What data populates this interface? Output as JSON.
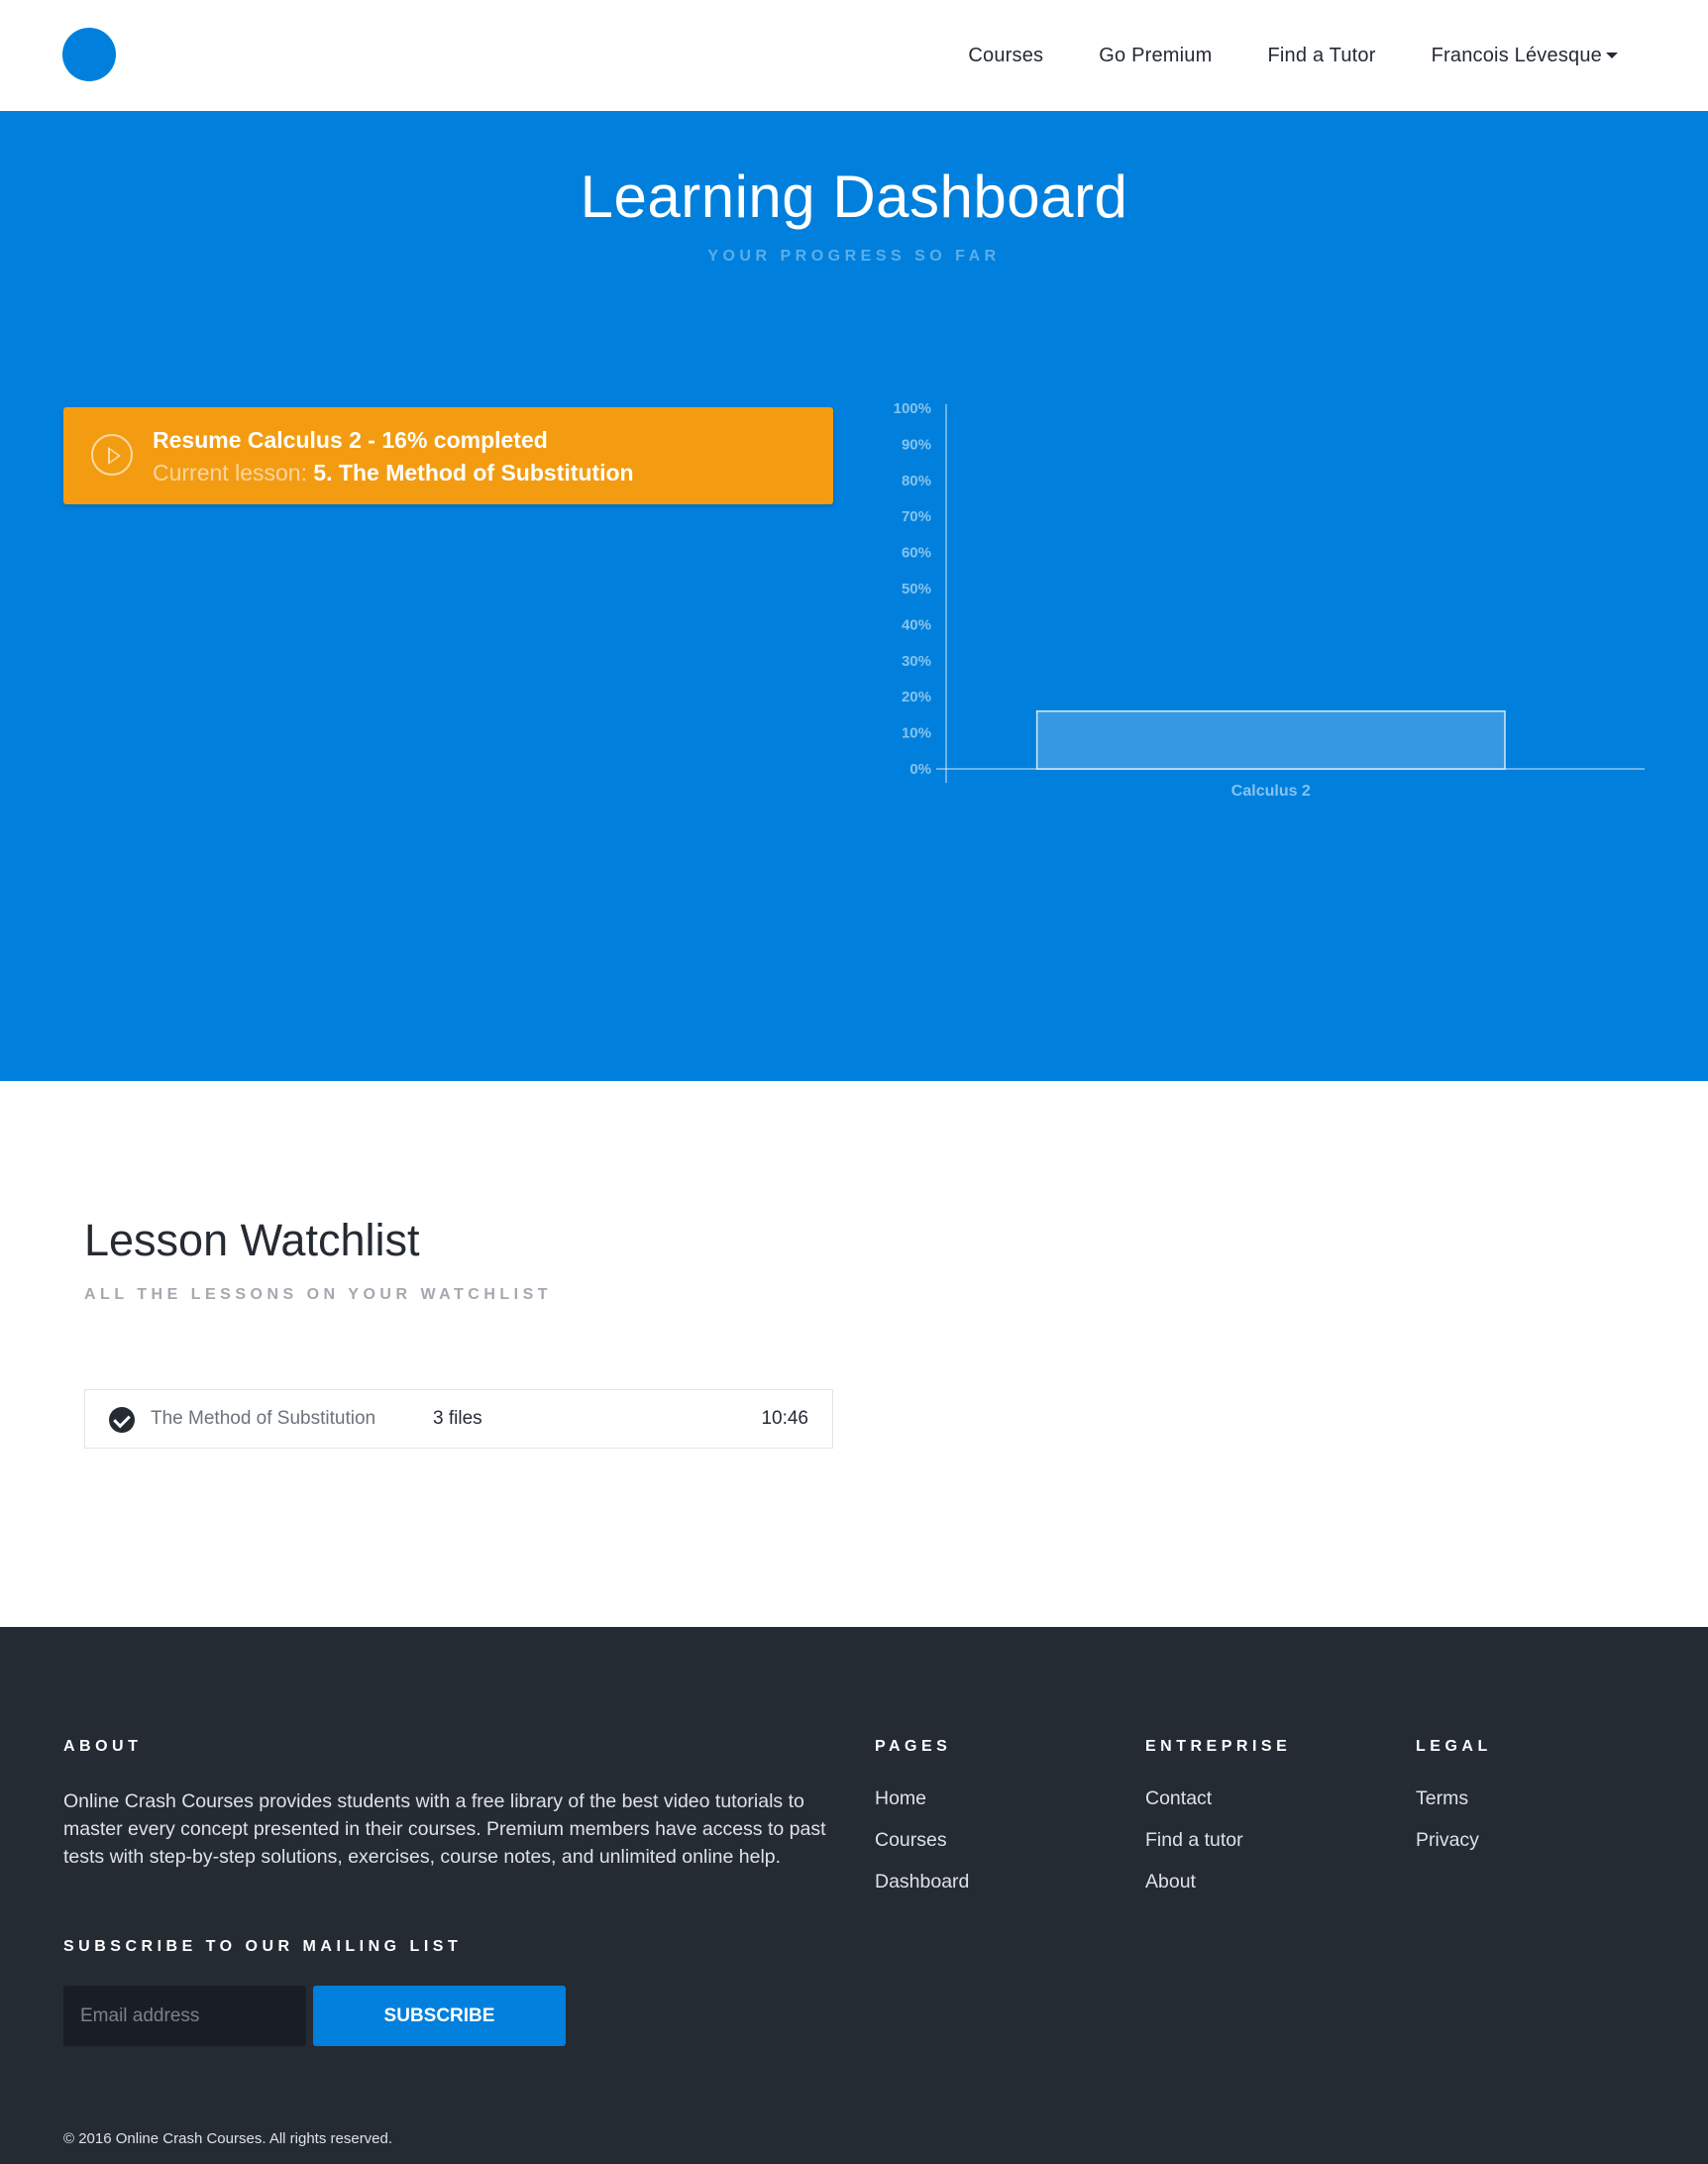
{
  "nav": {
    "links": [
      "Courses",
      "Go Premium",
      "Find a Tutor"
    ],
    "user_name": "Francois Lévesque"
  },
  "hero": {
    "title": "Learning Dashboard",
    "subtitle": "YOUR PROGRESS SO FAR",
    "resume": {
      "headline": "Resume Calculus 2 - 16% completed",
      "lesson_prefix": "Current lesson:",
      "lesson_name": "5. The Method of Substitution"
    }
  },
  "chart_data": {
    "type": "bar",
    "categories": [
      "Calculus 2"
    ],
    "values": [
      16
    ],
    "ylim": [
      0,
      100
    ],
    "yticks": [
      "0%",
      "10%",
      "20%",
      "30%",
      "40%",
      "50%",
      "60%",
      "70%",
      "80%",
      "90%",
      "100%"
    ],
    "grid": false,
    "bar_color": "#3498e3"
  },
  "watchlist": {
    "title": "Lesson Watchlist",
    "subtitle": "ALL THE LESSONS ON YOUR WATCHLIST",
    "items": [
      {
        "name": "The Method of Substitution",
        "files": "3 files",
        "duration": "10:46"
      }
    ]
  },
  "footer": {
    "about_heading": "ABOUT",
    "about_text": "Online Crash Courses provides students with a free library of the best video tutorials to master every concept presented in their courses. Premium members have access to past tests with step-by-step solutions, exercises, course notes, and unlimited online help.",
    "pages_heading": "PAGES",
    "pages": [
      "Home",
      "Courses",
      "Dashboard"
    ],
    "entreprise_heading": "ENTREPRISE",
    "entreprise": [
      "Contact",
      "Find a tutor",
      "About"
    ],
    "legal_heading": "LEGAL",
    "legal": [
      "Terms",
      "Privacy"
    ],
    "subscribe_heading": "SUBSCRIBE TO OUR MAILING LIST",
    "email_placeholder": "Email address",
    "subscribe_label": "SUBSCRIBE",
    "copyright": "© 2016 Online Crash Courses. All rights reserved."
  },
  "colors": {
    "brand_blue": "#0080dc",
    "accent_orange": "#f39c12",
    "footer_bg": "#252b33"
  }
}
